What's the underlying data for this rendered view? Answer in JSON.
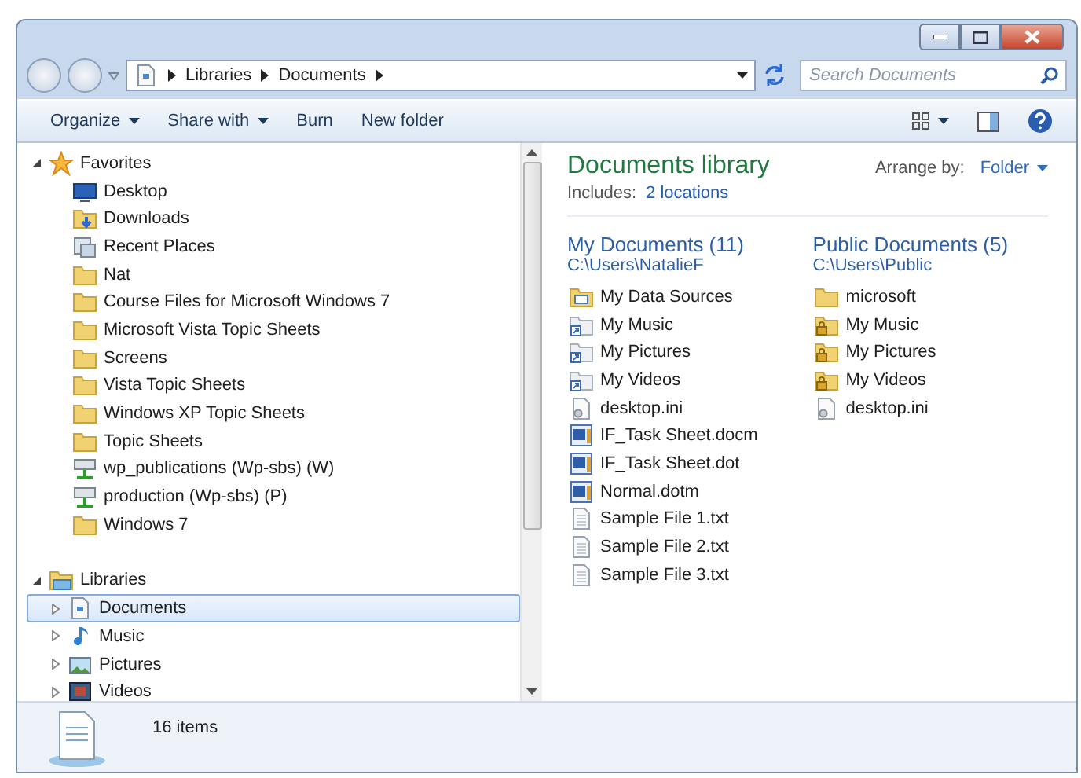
{
  "address": {
    "crumbs": [
      "Libraries",
      "Documents"
    ]
  },
  "search": {
    "placeholder": "Search Documents"
  },
  "toolbar": {
    "items": [
      {
        "label": "Organize",
        "dropdown": true
      },
      {
        "label": "Share with",
        "dropdown": true
      },
      {
        "label": "Burn",
        "dropdown": false
      },
      {
        "label": "New folder",
        "dropdown": false
      }
    ]
  },
  "nav": {
    "groups": [
      {
        "label": "Favorites",
        "kind": "star",
        "expanded": true,
        "children": [
          {
            "label": "Desktop",
            "kind": "desktop",
            "selected": false
          },
          {
            "label": "Downloads",
            "kind": "downloads",
            "selected": false
          },
          {
            "label": "Recent Places",
            "kind": "recent",
            "selected": false
          },
          {
            "label": "Nat",
            "kind": "folder",
            "selected": false
          },
          {
            "label": "Course Files for Microsoft Windows 7",
            "kind": "folder",
            "selected": false
          },
          {
            "label": "Microsoft Vista Topic Sheets",
            "kind": "folder",
            "selected": false
          },
          {
            "label": "Screens",
            "kind": "folder",
            "selected": false
          },
          {
            "label": "Vista Topic Sheets",
            "kind": "folder",
            "selected": false
          },
          {
            "label": "Windows XP Topic Sheets",
            "kind": "folder",
            "selected": false
          },
          {
            "label": "Topic Sheets",
            "kind": "folder",
            "selected": false
          },
          {
            "label": "wp_publications (Wp-sbs) (W)",
            "kind": "network",
            "selected": false
          },
          {
            "label": "production (Wp-sbs) (P)",
            "kind": "network",
            "selected": false
          },
          {
            "label": "Windows 7",
            "kind": "folder",
            "selected": false
          }
        ]
      },
      {
        "label": "Libraries",
        "kind": "libraries",
        "expanded": true,
        "children": [
          {
            "label": "Documents",
            "kind": "documents",
            "expanded": false,
            "selected": true
          },
          {
            "label": "Music",
            "kind": "music",
            "expanded": false,
            "selected": false
          },
          {
            "label": "Pictures",
            "kind": "pictures",
            "expanded": false,
            "selected": false
          },
          {
            "label": "Videos",
            "kind": "videos",
            "expanded": false,
            "selected": false
          }
        ]
      }
    ]
  },
  "library": {
    "title": "Documents library",
    "includes_label": "Includes:",
    "includes_link": "2 locations",
    "arrange_label": "Arrange by:",
    "arrange_value": "Folder"
  },
  "locations": [
    {
      "title": "My Documents (11)",
      "path": "C:\\Users\\NatalieF",
      "files": [
        {
          "name": "My Data Sources",
          "kind": "datasources"
        },
        {
          "name": "My Music",
          "kind": "shortcut"
        },
        {
          "name": "My Pictures",
          "kind": "shortcut"
        },
        {
          "name": "My Videos",
          "kind": "shortcut"
        },
        {
          "name": "desktop.ini",
          "kind": "ini"
        },
        {
          "name": "IF_Task Sheet.docm",
          "kind": "word"
        },
        {
          "name": "IF_Task Sheet.dot",
          "kind": "word"
        },
        {
          "name": "Normal.dotm",
          "kind": "word"
        },
        {
          "name": "Sample File 1.txt",
          "kind": "txt"
        },
        {
          "name": "Sample File 2.txt",
          "kind": "txt"
        },
        {
          "name": "Sample File 3.txt",
          "kind": "txt"
        }
      ]
    },
    {
      "title": "Public Documents (5)",
      "path": "C:\\Users\\Public",
      "files": [
        {
          "name": "microsoft",
          "kind": "folder"
        },
        {
          "name": "My Music",
          "kind": "locked"
        },
        {
          "name": "My Pictures",
          "kind": "locked"
        },
        {
          "name": "My Videos",
          "kind": "locked"
        },
        {
          "name": "desktop.ini",
          "kind": "ini"
        }
      ]
    }
  ],
  "status_bar": {
    "count": "16 items"
  }
}
